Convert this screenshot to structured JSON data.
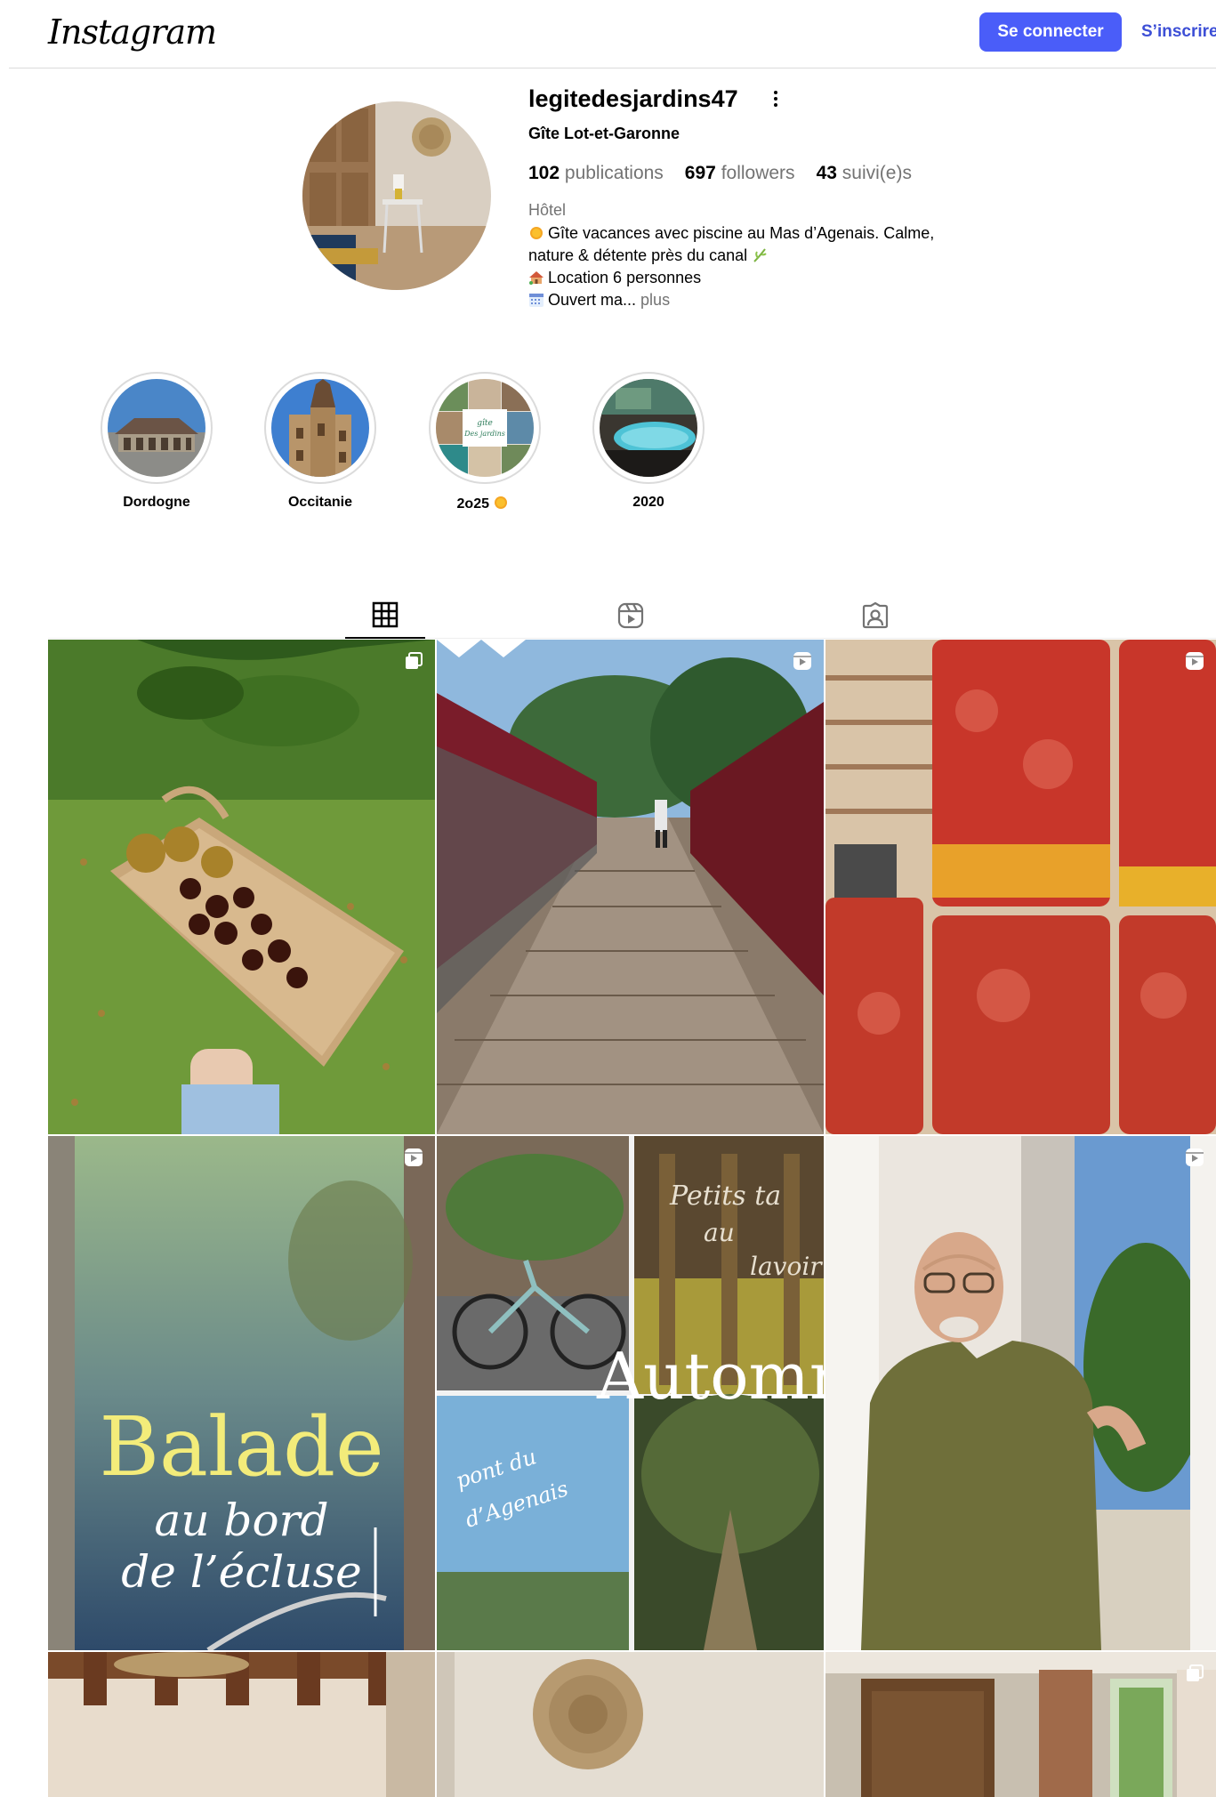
{
  "header": {
    "logo_text": "Instagram",
    "login_label": "Se connecter",
    "signup_label": "S’inscrire"
  },
  "profile": {
    "username": "legitedesjardins47",
    "full_name": "Gîte Lot-et-Garonne",
    "stats": {
      "posts_count": "102",
      "posts_label": "publications",
      "followers_count": "697",
      "followers_label": "followers",
      "following_count": "43",
      "following_label": "suivi(e)s"
    },
    "category": "Hôtel",
    "bio": {
      "line1": "Gîte vacances avec piscine au Mas d’Agenais. Calme,",
      "line2": "nature & détente près du canal",
      "line3": "Location 6 personnes",
      "line4": "Ouvert ma...",
      "more_label": "plus"
    }
  },
  "highlights": [
    {
      "label": "Dordogne"
    },
    {
      "label": "Occitanie"
    },
    {
      "label": "2o25"
    },
    {
      "label": "2020"
    }
  ],
  "highlight_thumb_text": {
    "gite": "gîte",
    "jardins": "Des jardins"
  },
  "tabs": [
    {
      "name": "posts",
      "icon": "grid-icon",
      "active": true
    },
    {
      "name": "reels",
      "icon": "reels-icon",
      "active": false
    },
    {
      "name": "tagged",
      "icon": "tagged-icon",
      "active": false
    }
  ],
  "posts": [
    {
      "type": "carousel",
      "subject": "basket of chestnuts"
    },
    {
      "type": "reel",
      "subject": "footbridge walk"
    },
    {
      "type": "reel",
      "subject": "tomato jars"
    },
    {
      "type": "reel",
      "subject": "canal lock",
      "overlay": {
        "title": "Balade",
        "line2": "au bord",
        "line3": "de l’écluse"
      }
    },
    {
      "type": "carousel",
      "subject": "autumn collage",
      "overlay": {
        "main": "Automn",
        "script1": "Petits ta",
        "script2": "au",
        "script3": "lavoir",
        "script4": "pont du",
        "script5": "d’Agenais"
      }
    },
    {
      "type": "reel",
      "subject": "host portrait"
    },
    {
      "type": "carousel",
      "subject": "interior beams"
    },
    {
      "type": "carousel",
      "subject": "wall basket"
    },
    {
      "type": "carousel",
      "subject": "bedroom window"
    }
  ],
  "colors": {
    "primary_button": "#4a5df9",
    "link": "#3d4fd6",
    "muted_text": "#737373",
    "divider": "#dbdbdb"
  }
}
